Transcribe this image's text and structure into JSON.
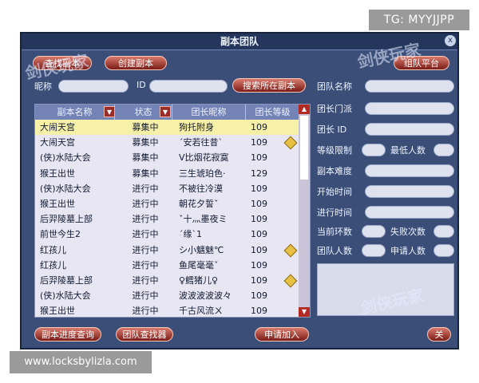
{
  "tg_label": "TG: MYYJJPP",
  "site_label": "www.locksbylizla.com",
  "window": {
    "title": "副本团队",
    "close_glyph": "x"
  },
  "top_buttons": {
    "find": "查找副本",
    "create": "创建副本",
    "platform": "组队平台"
  },
  "search": {
    "nickname_label": "昵称",
    "id_label": "ID",
    "button": "搜索所在副本"
  },
  "table": {
    "headers": {
      "name": "副本名称",
      "status": "状态",
      "leader": "团长昵称",
      "level": "团长等级"
    },
    "rows": [
      {
        "name": "大闹天宫",
        "status": "募集中",
        "leader": "狗托附身",
        "level": "109",
        "diamond": false,
        "selected": true
      },
      {
        "name": "大闹天宫",
        "status": "募集中",
        "leader": "ˊ安若往昔ˋ",
        "level": "109",
        "diamond": true,
        "selected": false
      },
      {
        "name": "(侠)水陆大会",
        "status": "募集中",
        "leader": "V比烟花寂寞",
        "level": "109",
        "diamond": false,
        "selected": false
      },
      {
        "name": "猴王出世",
        "status": "募集中",
        "leader": "三生琥珀色·",
        "level": "129",
        "diamond": false,
        "selected": false
      },
      {
        "name": "(侠)水陆大会",
        "status": "进行中",
        "leader": "不被往冷漠",
        "level": "109",
        "diamond": false,
        "selected": false
      },
      {
        "name": "猴王出世",
        "status": "进行中",
        "leader": "朝花夕誓ˇ",
        "level": "109",
        "diamond": false,
        "selected": false
      },
      {
        "name": "后羿陵墓上部",
        "status": "进行中",
        "leader": "ˇ十灬墨夜ミ",
        "level": "109",
        "diamond": false,
        "selected": false
      },
      {
        "name": "前世今生2",
        "status": "进行中",
        "leader": "ˊ缘ˋ1",
        "level": "109",
        "diamond": false,
        "selected": false
      },
      {
        "name": "红孩儿",
        "status": "进行中",
        "leader": "シ小魑魅℃",
        "level": "109",
        "diamond": true,
        "selected": false
      },
      {
        "name": "红孩儿",
        "status": "进行中",
        "leader": "鱼尾毫毫ˇ",
        "level": "109",
        "diamond": false,
        "selected": false
      },
      {
        "name": "后羿陵墓上部",
        "status": "进行中",
        "leader": "♀鳕猪儿♀",
        "level": "109",
        "diamond": true,
        "selected": false
      },
      {
        "name": "(侠)水陆大会",
        "status": "进行中",
        "leader": "波波波波波々",
        "level": "109",
        "diamond": false,
        "selected": false
      },
      {
        "name": "猴王出世",
        "status": "进行中",
        "leader": "千古风流ㄨ",
        "level": "109",
        "diamond": false,
        "selected": false
      }
    ]
  },
  "right_panel": {
    "team_name": "团队名称",
    "leader_sect": "团长门派",
    "leader_id": "团长 ID",
    "level_limit": "等级限制",
    "min_people": "最低人数",
    "difficulty": "副本难度",
    "start_time": "开始时间",
    "progress_time": "进行时间",
    "current_rounds": "当前环数",
    "fail_count": "失败次数",
    "team_count": "团队人数",
    "apply_count": "申请人数"
  },
  "bottom_buttons": {
    "progress": "副本进度查询",
    "team_find": "团队查找器",
    "apply": "申请加入",
    "close": "关"
  },
  "watermark": "剑侠玩家"
}
